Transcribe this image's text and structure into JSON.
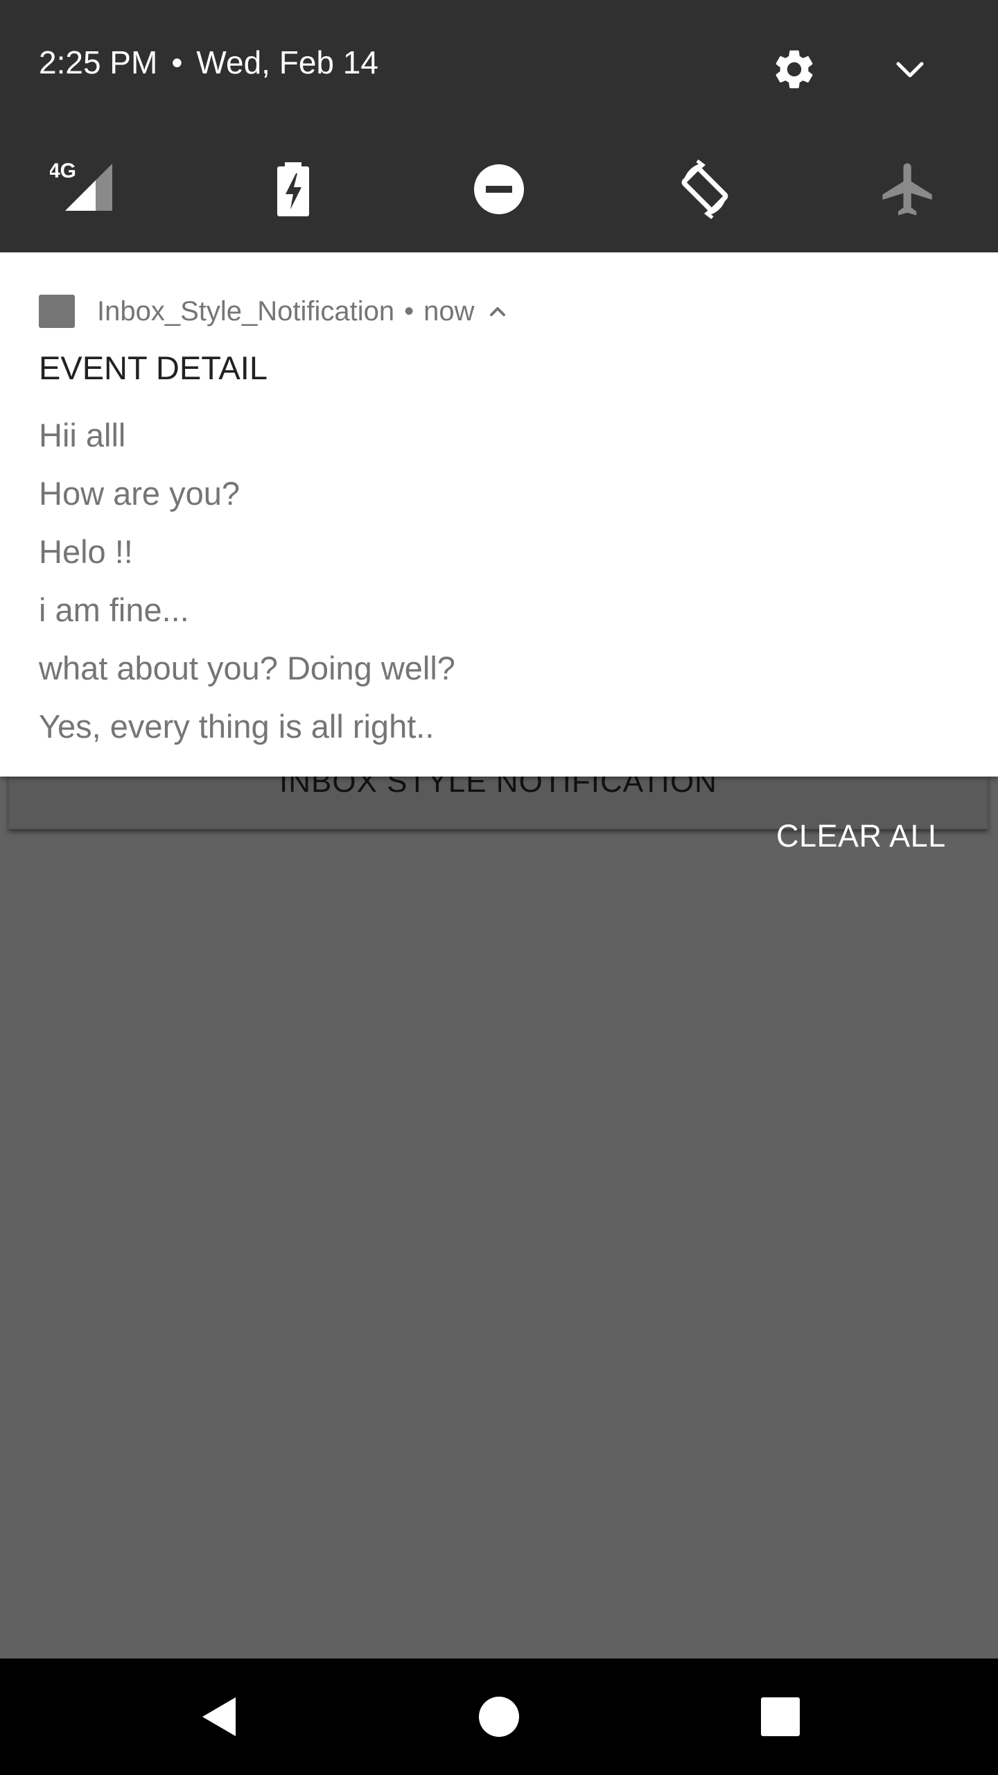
{
  "status_shade": {
    "time": "2:25 PM",
    "separator": "•",
    "date": "Wed, Feb 14",
    "settings_icon": "gear-icon",
    "expand_icon": "chevron-down-icon"
  },
  "quick_settings": [
    {
      "icon": "cellular-4g-icon",
      "label": "4G"
    },
    {
      "icon": "battery-saver-icon"
    },
    {
      "icon": "do-not-disturb-icon"
    },
    {
      "icon": "auto-rotate-icon"
    },
    {
      "icon": "airplane-mode-icon"
    }
  ],
  "notification": {
    "app_name": "Inbox_Style_Notification",
    "separator": "•",
    "time": "now",
    "title": "EVENT DETAIL",
    "lines": [
      "Hii alll",
      "How are you?",
      "Helo !!",
      "i am fine...",
      "what about you? Doing well?",
      "Yes, every thing is all right.."
    ]
  },
  "background_app": {
    "button_label": "INBOX STYLE NOTIFICATION"
  },
  "clear_all_label": "CLEAR ALL",
  "nav_bar": {
    "back": "back-icon",
    "home": "home-icon",
    "recents": "recents-icon"
  },
  "colors": {
    "shade_bg": "#303030",
    "scrim": "#616161",
    "card_bg": "#ffffff",
    "secondary_text": "#757575",
    "primary_text": "#212121"
  }
}
